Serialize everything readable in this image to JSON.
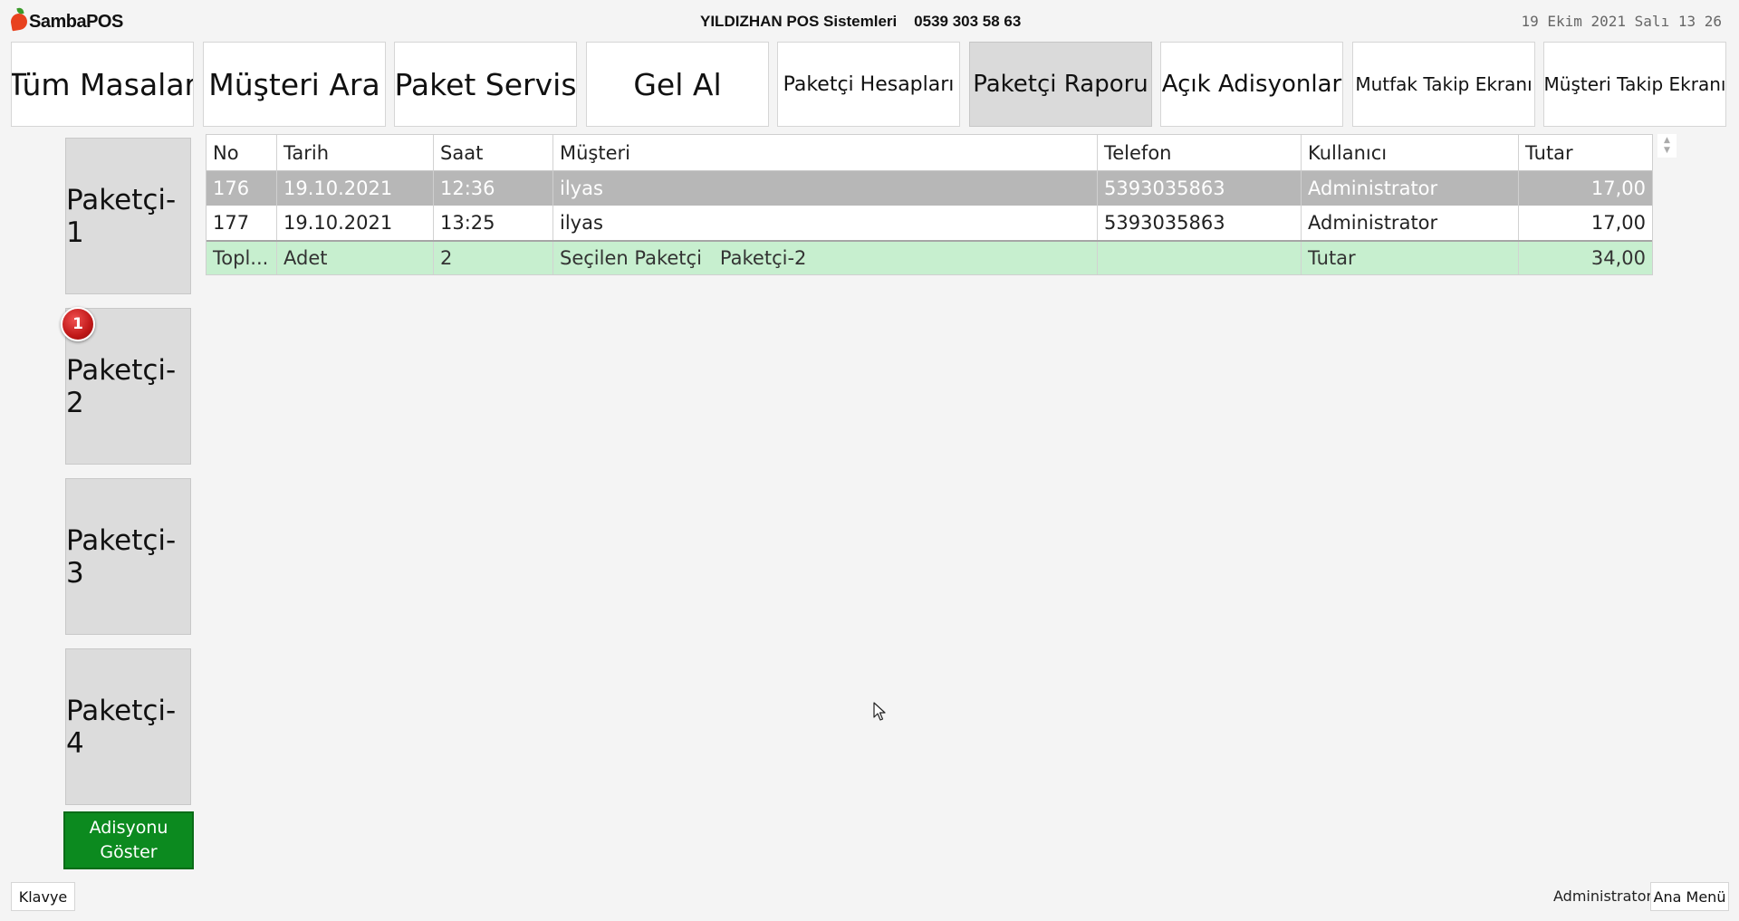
{
  "header": {
    "logo_text": "SambaPOS",
    "company": "YILDIZHAN POS Sistemleri    0539 303 58 63",
    "datetime": "19 Ekim 2021 Salı 13 26"
  },
  "top_buttons": [
    {
      "label": "Tüm Masalar"
    },
    {
      "label": "Müşteri Ara"
    },
    {
      "label": "Paket Servis"
    },
    {
      "label": "Gel Al"
    },
    {
      "label": "Paketçi Hesapları"
    },
    {
      "label": "Paketçi Raporu"
    },
    {
      "label": "Açık Adisyonlar"
    },
    {
      "label": "Mutfak Takip Ekranı"
    },
    {
      "label": "Müşteri Takip Ekranı"
    }
  ],
  "paketciler": [
    {
      "label": "Paketçi-1"
    },
    {
      "label": "Paketçi-2",
      "badge": "1"
    },
    {
      "label": "Paketçi-3"
    },
    {
      "label": "Paketçi-4"
    }
  ],
  "show_ticket_button": {
    "line1": "Adisyonu",
    "line2": "Göster"
  },
  "table": {
    "columns": [
      "No",
      "Tarih",
      "Saat",
      "Müşteri",
      "Telefon",
      "Kullanıcı",
      "Tutar"
    ],
    "rows": [
      [
        "176",
        "19.10.2021",
        "12:36",
        "ilyas",
        "5393035863",
        "Administrator",
        "17,00"
      ],
      [
        "177",
        "19.10.2021",
        "13:25",
        "ilyas",
        "5393035863",
        "Administrator",
        "17,00"
      ]
    ],
    "total": [
      "Topl...",
      "Adet",
      "2",
      "Seçilen Paketçi   Paketçi-2",
      "",
      "Tutar",
      "34,00"
    ]
  },
  "footer": {
    "keyboard_label": "Klavye",
    "user": "Administrator",
    "main_menu_label": "Ana Menü"
  },
  "colors": {
    "selected_row": "#b7b7b7",
    "total_row": "#c7efcf",
    "show_button": "#0c8a1f",
    "badge": "#c01818"
  }
}
